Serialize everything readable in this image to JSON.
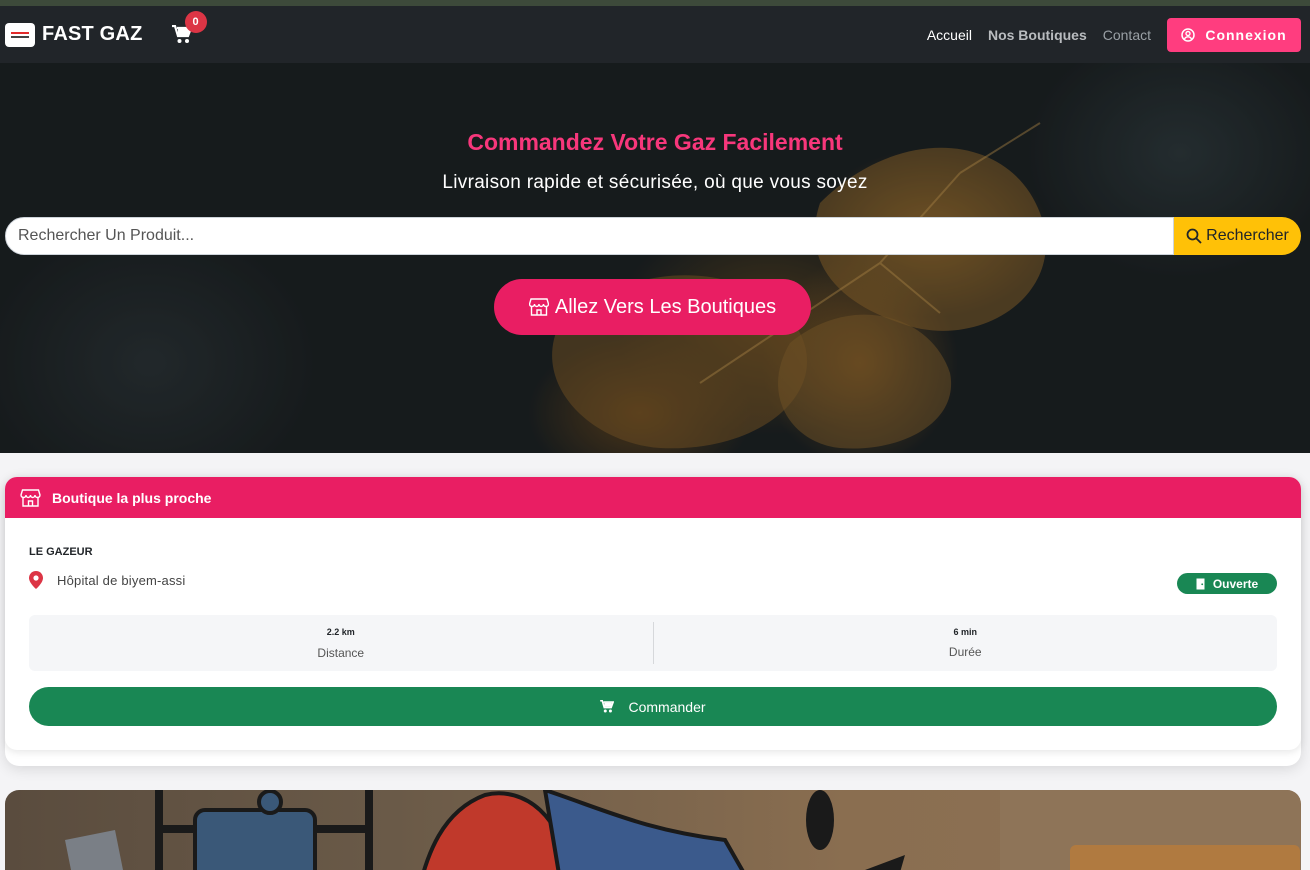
{
  "navbar": {
    "brand": "FAST GAZ",
    "cart_count": "0",
    "links": {
      "home": "Accueil",
      "shops": "Nos Boutiques",
      "contact": "Contact"
    },
    "login_label": "Connexion"
  },
  "hero": {
    "title": "Commandez Votre Gaz Facilement",
    "subtitle": "Livraison rapide et sécurisée, où que vous soyez",
    "search": {
      "placeholder": "Rechercher Un Produit...",
      "button_label": "Rechercher"
    },
    "shops_button": "Allez Vers Les Boutiques"
  },
  "nearest_shop": {
    "header": "Boutique la plus proche",
    "name": "LE GAZEUR",
    "address": "Hôpital de biyem-assi",
    "status": "Ouverte",
    "distance": {
      "value": "2.2 km",
      "label": "Distance"
    },
    "duration": {
      "value": "6 min",
      "label": "Durée"
    },
    "order_button": "Commander"
  },
  "colors": {
    "navbar": "#212529",
    "accent_pink": "#e91e63",
    "login_pink": "#ff3d7f",
    "search_yellow": "#ffc107",
    "success_green": "#198754",
    "title_pink": "#f7377b"
  },
  "icons": {
    "cart": "cart-icon",
    "login": "user-circle-icon",
    "search": "search-icon",
    "shop": "shop-icon",
    "location": "map-pin-icon",
    "status": "door-icon",
    "order": "cart-icon"
  }
}
